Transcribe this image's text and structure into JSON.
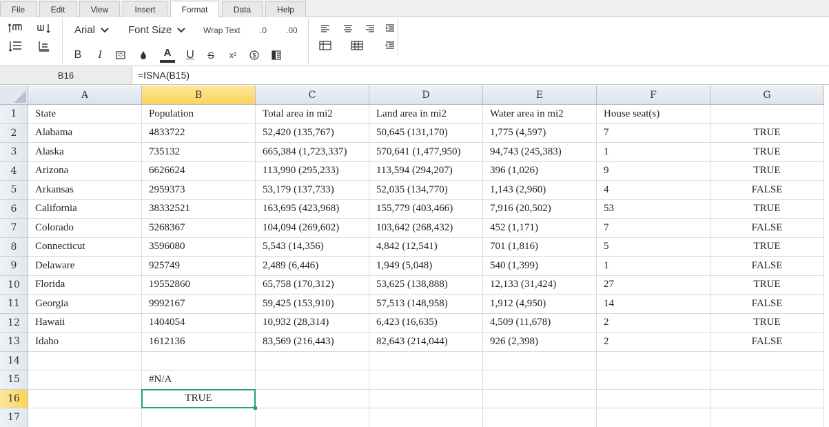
{
  "menu": {
    "tabs": [
      {
        "label": "File"
      },
      {
        "label": "Edit"
      },
      {
        "label": "View"
      },
      {
        "label": "Insert"
      },
      {
        "label": "Format"
      },
      {
        "label": "Data"
      },
      {
        "label": "Help"
      }
    ],
    "active_tab": "Format"
  },
  "toolbar": {
    "font_family": "Arial",
    "font_size": "Font Size",
    "wrap_text": "Wrap Text",
    "decrease_decimal": ".0",
    "increase_decimal": ".00",
    "bold": "B",
    "italic": "I",
    "underline": "U",
    "strike": "S",
    "superscript": "x²",
    "currency": "$",
    "font_color_letter": "A"
  },
  "formula_bar": {
    "cell_ref": "B16",
    "formula": "=ISNA(B15)"
  },
  "sheet": {
    "columns": [
      "A",
      "B",
      "C",
      "D",
      "E",
      "F",
      "G"
    ],
    "selected_column": "B",
    "selected_row": "16",
    "rows": [
      {
        "num": "1",
        "cells": [
          "State",
          "Population",
          "Total area in mi2",
          "Land area in mi2",
          "Water area in mi2",
          "House seat(s)",
          ""
        ]
      },
      {
        "num": "2",
        "cells": [
          "Alabama",
          "4833722",
          "52,420 (135,767)",
          "50,645 (131,170)",
          "1,775 (4,597)",
          "7",
          "TRUE"
        ]
      },
      {
        "num": "3",
        "cells": [
          "Alaska",
          "735132",
          "665,384 (1,723,337)",
          "570,641 (1,477,950)",
          "94,743 (245,383)",
          "1",
          "TRUE"
        ]
      },
      {
        "num": "4",
        "cells": [
          "Arizona",
          "6626624",
          "113,990 (295,233)",
          "113,594 (294,207)",
          "396 (1,026)",
          "9",
          "TRUE"
        ]
      },
      {
        "num": "5",
        "cells": [
          "Arkansas",
          "2959373",
          "53,179 (137,733)",
          "52,035 (134,770)",
          "1,143 (2,960)",
          "4",
          "FALSE"
        ]
      },
      {
        "num": "6",
        "cells": [
          "California",
          "38332521",
          "163,695 (423,968)",
          "155,779 (403,466)",
          "7,916 (20,502)",
          "53",
          "TRUE"
        ]
      },
      {
        "num": "7",
        "cells": [
          "Colorado",
          "5268367",
          "104,094 (269,602)",
          "103,642 (268,432)",
          "452 (1,171)",
          "7",
          "FALSE"
        ]
      },
      {
        "num": "8",
        "cells": [
          "Connecticut",
          "3596080",
          "5,543 (14,356)",
          "4,842 (12,541)",
          "701 (1,816)",
          "5",
          "TRUE"
        ]
      },
      {
        "num": "9",
        "cells": [
          "Delaware",
          "925749",
          "2,489 (6,446)",
          "1,949 (5,048)",
          "540 (1,399)",
          "1",
          "FALSE"
        ]
      },
      {
        "num": "10",
        "cells": [
          "Florida",
          "19552860",
          "65,758 (170,312)",
          "53,625 (138,888)",
          "12,133 (31,424)",
          "27",
          "TRUE"
        ]
      },
      {
        "num": "11",
        "cells": [
          "Georgia",
          "9992167",
          "59,425 (153,910)",
          "57,513 (148,958)",
          "1,912 (4,950)",
          "14",
          "FALSE"
        ]
      },
      {
        "num": "12",
        "cells": [
          "Hawaii",
          "1404054",
          "10,932 (28,314)",
          "6,423 (16,635)",
          "4,509 (11,678)",
          "2",
          "TRUE"
        ]
      },
      {
        "num": "13",
        "cells": [
          "Idaho",
          "1612136",
          "83,569 (216,443)",
          "82,643 (214,044)",
          "926 (2,398)",
          "2",
          "FALSE"
        ]
      },
      {
        "num": "14",
        "cells": [
          "",
          "",
          "",
          "",
          "",
          "",
          ""
        ]
      },
      {
        "num": "15",
        "cells": [
          "",
          "#N/A",
          "",
          "",
          "",
          "",
          ""
        ]
      },
      {
        "num": "16",
        "cells": [
          "",
          "TRUE",
          "",
          "",
          "",
          "",
          ""
        ]
      },
      {
        "num": "17",
        "cells": [
          "",
          "",
          "",
          "",
          "",
          "",
          ""
        ]
      }
    ]
  },
  "colors": {
    "selection": "#21a27c",
    "header_selected": "#fcd35a"
  }
}
